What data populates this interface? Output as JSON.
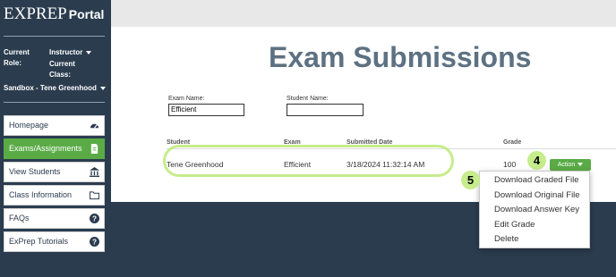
{
  "brand": {
    "name": "EXPREP",
    "sub": "Portal"
  },
  "user": {
    "role_label": "Current Role:",
    "role_value": "Instructor",
    "class_label": "Current Class:",
    "class_value": "Sandbox - Tene Greenhood"
  },
  "nav": [
    {
      "label": "Homepage",
      "icon": "dashboard-icon"
    },
    {
      "label": "Exams/Assignments",
      "icon": "document-icon",
      "active": true
    },
    {
      "label": "View Students",
      "icon": "bank-icon"
    },
    {
      "label": "Class Information",
      "icon": "folder-icon"
    },
    {
      "label": "FAQs",
      "icon": "help-icon"
    },
    {
      "label": "ExPrep Tutorials",
      "icon": "help-icon"
    }
  ],
  "page": {
    "title": "Exam Submissions"
  },
  "filters": {
    "exam_label": "Exam Name:",
    "exam_value": "Efficient",
    "student_label": "Student Name:",
    "student_value": ""
  },
  "table": {
    "headers": [
      "Student",
      "Exam",
      "Submitted Date",
      "Grade"
    ],
    "row": {
      "student": "Tene Greenhood",
      "exam": "Efficient",
      "date": "3/18/2024 11:32:14 AM",
      "grade": "100"
    },
    "action_label": "Action"
  },
  "menu": [
    "Download Graded File",
    "Download Original File",
    "Download Answer Key",
    "Edit Grade",
    "Delete"
  ],
  "callouts": {
    "action": "4",
    "menu": "5"
  },
  "colors": {
    "sidebar": "#2b3c4f",
    "accent": "#5aab46",
    "highlight": "#c6ec8b",
    "title": "#5d7182"
  }
}
